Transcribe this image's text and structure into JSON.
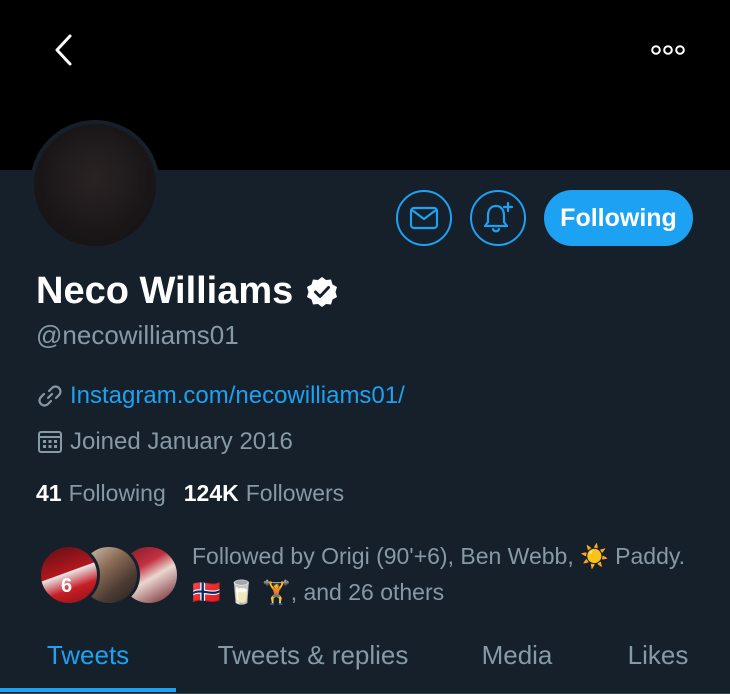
{
  "header": {
    "back_icon": "chevron-left-icon",
    "more_icon": "more-horizontal-icon"
  },
  "actions": {
    "message_icon": "mail-icon",
    "notify_icon": "bell-plus-icon",
    "following_label": "Following"
  },
  "profile": {
    "name": "Neco Williams",
    "verified_icon": "verified-badge-icon",
    "handle": "@necowilliams01",
    "link": "Instagram.com/necowilliams01/",
    "joined": "Joined January 2016"
  },
  "stats": {
    "following_count": "41",
    "following_label": "Following",
    "followers_count": "124K",
    "followers_label": "Followers"
  },
  "followed_by": {
    "text": "Followed by Origi (90'+6), Ben Webb, ☀️ Paddy. 🇳🇴 🥛 🏋️, and 26 others",
    "avatar_number": "6"
  },
  "tabs": [
    {
      "label": "Tweets"
    },
    {
      "label": "Tweets & replies"
    },
    {
      "label": "Media"
    },
    {
      "label": "Likes"
    }
  ],
  "colors": {
    "accent": "#1da1f2",
    "background": "#15202b",
    "secondary_text": "#8899a6"
  }
}
